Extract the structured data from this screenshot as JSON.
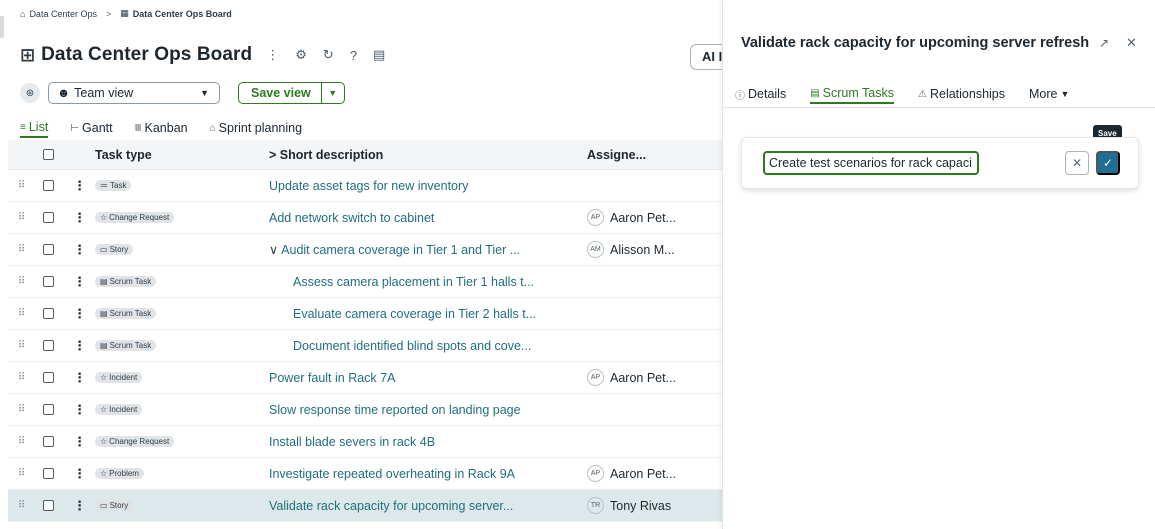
{
  "breadcrumb": {
    "root_label": "Data Center Ops",
    "separator": ">",
    "current_label": "Data Center Ops Board"
  },
  "board": {
    "title": "Data Center Ops Board",
    "ai_label": "AI I"
  },
  "view_bar": {
    "team_view_label": "Team view",
    "save_view_label": "Save view"
  },
  "view_tabs": [
    {
      "label": "List",
      "icon": "list-icon",
      "active": true
    },
    {
      "label": "Gantt",
      "icon": "gantt-icon",
      "active": false
    },
    {
      "label": "Kanban",
      "icon": "kanban-icon",
      "active": false
    },
    {
      "label": "Sprint planning",
      "icon": "sprint-icon",
      "active": false
    }
  ],
  "grid": {
    "columns": {
      "task_type": "Task type",
      "short_description": "Short description",
      "assignee": "Assigne..."
    },
    "expand_glyph": ">",
    "rows": [
      {
        "type": "Task",
        "type_icon": "task-icon",
        "description": "Update asset tags for new inventory",
        "assignee_initials": "",
        "assignee_name": "",
        "level": 0,
        "selected": false
      },
      {
        "type": "Change Request",
        "type_icon": "star-icon",
        "description": "Add network switch to cabinet",
        "assignee_initials": "AP",
        "assignee_name": "Aaron Pet...",
        "level": 0,
        "selected": false
      },
      {
        "type": "Story",
        "type_icon": "story-icon",
        "description": "Audit camera coverage in Tier 1 and Tier ...",
        "assignee_initials": "AM",
        "assignee_name": "Alisson M...",
        "level": 1,
        "selected": false
      },
      {
        "type": "Scrum Task",
        "type_icon": "scrum-task-icon",
        "description": "Assess camera placement in Tier 1 halls t...",
        "assignee_initials": "",
        "assignee_name": "",
        "level": 2,
        "selected": false
      },
      {
        "type": "Scrum Task",
        "type_icon": "scrum-task-icon",
        "description": "Evaluate camera coverage in Tier 2 halls t...",
        "assignee_initials": "",
        "assignee_name": "",
        "level": 2,
        "selected": false
      },
      {
        "type": "Scrum Task",
        "type_icon": "scrum-task-icon",
        "description": "Document identified blind spots and cove...",
        "assignee_initials": "",
        "assignee_name": "",
        "level": 2,
        "selected": false
      },
      {
        "type": "Incident",
        "type_icon": "star-icon",
        "description": "Power fault in Rack 7A",
        "assignee_initials": "AP",
        "assignee_name": "Aaron Pet...",
        "level": 0,
        "selected": false
      },
      {
        "type": "Incident",
        "type_icon": "star-icon",
        "description": "Slow response time reported on landing page",
        "assignee_initials": "",
        "assignee_name": "",
        "level": 0,
        "selected": false
      },
      {
        "type": "Change Request",
        "type_icon": "star-icon",
        "description": "Install blade severs in rack 4B",
        "assignee_initials": "",
        "assignee_name": "",
        "level": 0,
        "selected": false
      },
      {
        "type": "Problem",
        "type_icon": "star-icon",
        "description": "Investigate repeated overheating in Rack 9A",
        "assignee_initials": "AP",
        "assignee_name": "Aaron Pet...",
        "level": 0,
        "selected": false
      },
      {
        "type": "Story",
        "type_icon": "story-icon",
        "description": "Validate rack capacity for upcoming server...",
        "assignee_initials": "TR",
        "assignee_name": "Tony Rivas",
        "level": 0,
        "selected": true
      }
    ]
  },
  "panel": {
    "title": "Validate rack capacity for upcoming server refresh",
    "tabs": [
      {
        "label": "Details",
        "icon": "info-icon",
        "active": false
      },
      {
        "label": "Scrum Tasks",
        "icon": "scrum-task-icon",
        "active": true
      },
      {
        "label": "Relationships",
        "icon": "relationships-icon",
        "active": false
      },
      {
        "label": "More",
        "icon": "caret-down-icon",
        "active": false
      }
    ],
    "edit": {
      "input_value": "Create test scenarios for rack capaci",
      "save_tooltip": "Save"
    }
  },
  "colors": {
    "accent_green": "#2d7a1f",
    "link_teal": "#1f6f7d",
    "save_blue": "#1f6f95",
    "selected_row": "#dde8ea"
  }
}
